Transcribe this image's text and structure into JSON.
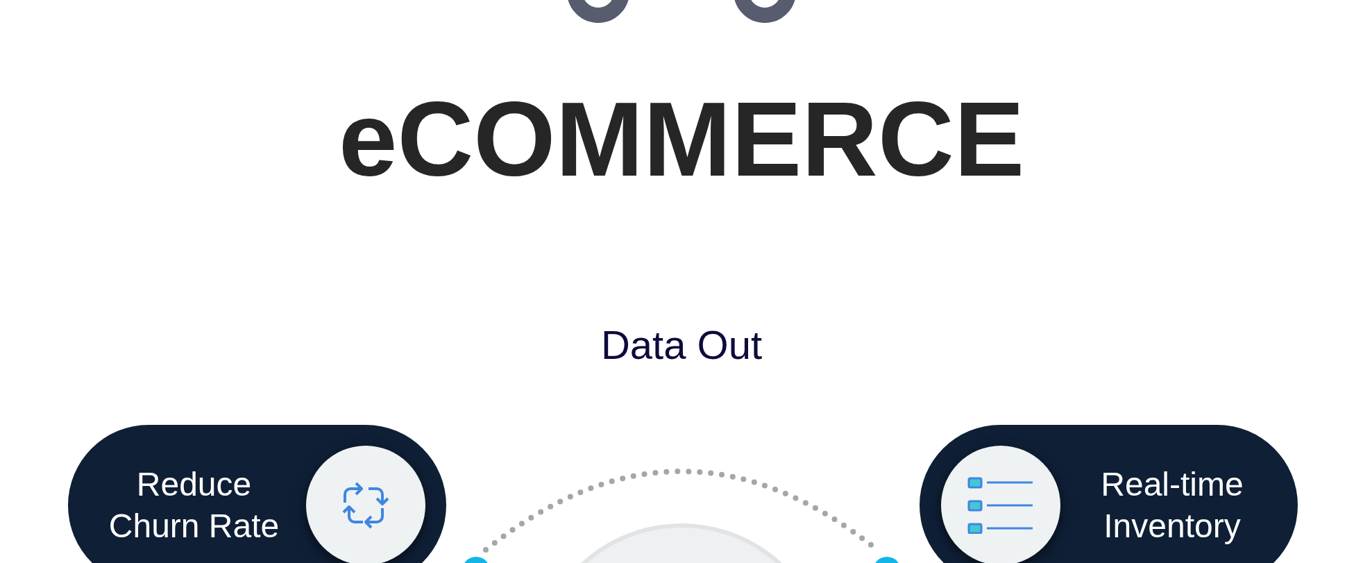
{
  "title": "eCOMMERCE",
  "subtitle": "Data Out",
  "bubbles": [
    {
      "lines": [
        "Reduce",
        "Churn Rate"
      ],
      "kind": "cycle",
      "icon_first": false
    },
    {
      "lines": [
        "Real-time",
        "Inventory"
      ],
      "kind": "list",
      "icon_first": true
    }
  ]
}
